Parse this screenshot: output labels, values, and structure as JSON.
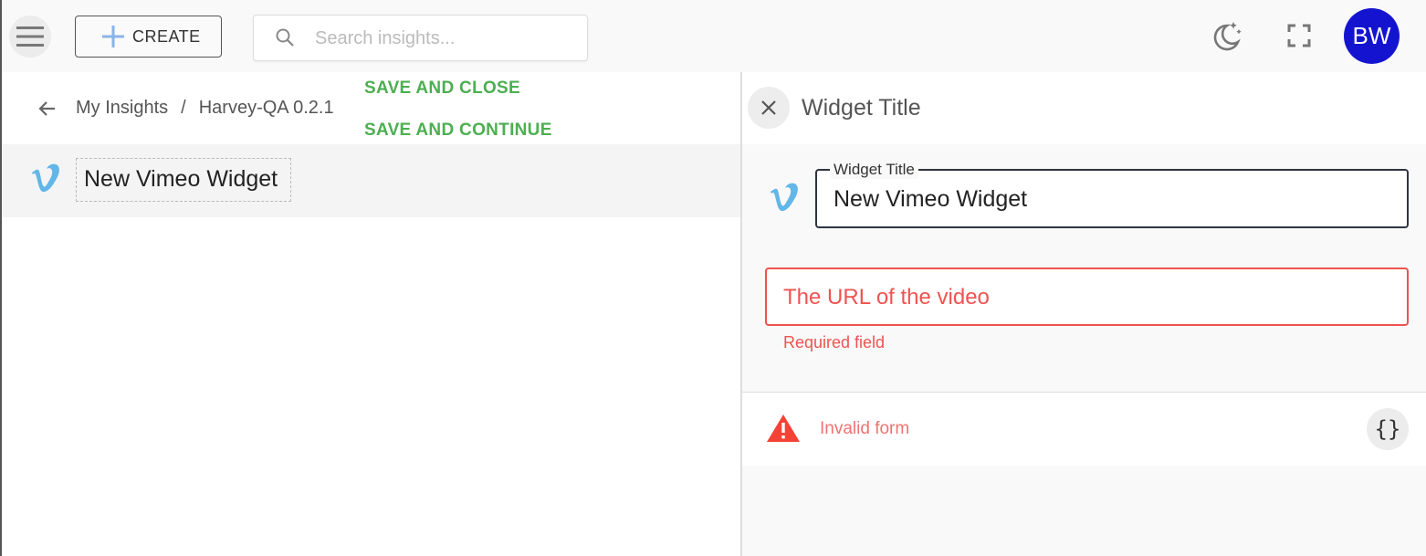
{
  "topbar": {
    "create_label": "CREATE",
    "search_placeholder": "Search insights...",
    "avatar_initials": "BW",
    "icons": [
      "menu-icon",
      "plus-icon",
      "search-icon",
      "moon-stars-icon",
      "fullscreen-icon"
    ]
  },
  "breadcrumb": {
    "items": [
      "My Insights",
      "Harvey-QA 0.2.1"
    ],
    "separator": "/"
  },
  "actions": {
    "save_close": "SAVE AND CLOSE",
    "save_continue": "SAVE AND CONTINUE"
  },
  "widget_list": {
    "items": [
      {
        "title": "New Vimeo Widget",
        "icon": "vimeo-icon"
      }
    ]
  },
  "editor": {
    "header_title": "Widget Title",
    "title_field": {
      "label": "Widget Title",
      "value": "New Vimeo Widget"
    },
    "url_field": {
      "placeholder": "The URL of the video",
      "value": "",
      "error": "Required field"
    },
    "status": "Invalid form",
    "json_button_label": "{}"
  },
  "colors": {
    "accent_green": "#4caf50",
    "error_red": "#ef5350",
    "avatar_bg": "#1414d0",
    "vimeo_blue": "#62b6e8"
  }
}
